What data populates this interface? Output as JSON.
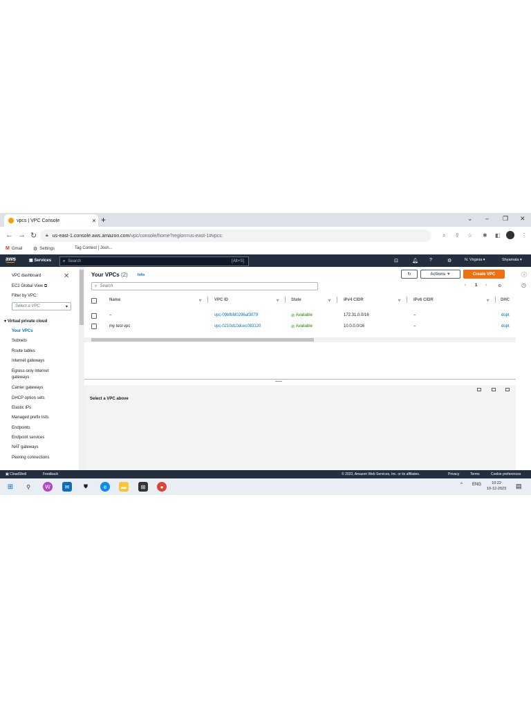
{
  "browser": {
    "tab_title": "vpcs | VPC Console",
    "tab_close": "×",
    "new_tab": "+",
    "url_host": "us-east-1.console.aws.amazon.com",
    "url_path": "/vpc/console/home?region=us-east-1#vpcs:",
    "bookmarks": [
      {
        "label": "Gmail",
        "icon": "gmail-icon"
      },
      {
        "label": "Settings",
        "icon": "gear-icon"
      },
      {
        "label": "Tag Contest | Josh..."
      }
    ]
  },
  "aws_nav": {
    "logo": "aws",
    "services": "Services",
    "search_placeholder": "Search",
    "search_shortcut": "[Alt+S]",
    "region": "N. Virginia ▾",
    "user": "Shyamala ▾"
  },
  "sidebar": {
    "dashboard": "VPC dashboard",
    "ec2_global": "EC2 Global View",
    "filter_label": "Filter by VPC:",
    "filter_placeholder": "Select a VPC",
    "section": "Virtual private cloud",
    "items": [
      "Your VPCs",
      "Subnets",
      "Route tables",
      "Internet gateways",
      "Egress-only internet",
      "gateways",
      "Carrier gateways",
      "DHCP option sets",
      "Elastic IPs",
      "Managed prefix lists",
      "Endpoints",
      "Endpoint services",
      "NAT gateways",
      "Peering connections"
    ]
  },
  "main": {
    "title": "Your VPCs",
    "count": "(2)",
    "info": "Info",
    "actions": "Actions ▼",
    "create": "Create VPC",
    "search_placeholder": "Search",
    "page": "1",
    "columns": [
      "Name",
      "VPC ID",
      "State",
      "IPv4 CIDR",
      "IPv6 CIDR",
      "DHC"
    ],
    "rows": [
      {
        "name": "–",
        "vpc_id": "vpc-09bfbfd0296af3079",
        "state": "Available",
        "ipv4": "172.31.0.0/16",
        "ipv6": "–",
        "dhcp": "dopt"
      },
      {
        "name": "my test vpc",
        "vpc_id": "vpc-0210d10dcec083120",
        "state": "Available",
        "ipv4": "10.0.0.0/16",
        "ipv6": "–",
        "dhcp": "dopt"
      }
    ],
    "detail_empty": "Select a VPC above"
  },
  "footer": {
    "cloudshell": "CloudShell",
    "feedback": "Feedback",
    "copyright": "© 2023, Amazon Web Services, Inc. or its affiliates.",
    "privacy": "Privacy",
    "terms": "Terms",
    "cookies": "Cookie preferences"
  },
  "taskbar": {
    "language": "ENG",
    "time": "10:22",
    "date": "10-12-2023"
  },
  "colors": {
    "aws_nav": "#232f3e",
    "accent_orange": "#ec7211",
    "link_blue": "#0073bb",
    "status_green": "#1d8102"
  }
}
